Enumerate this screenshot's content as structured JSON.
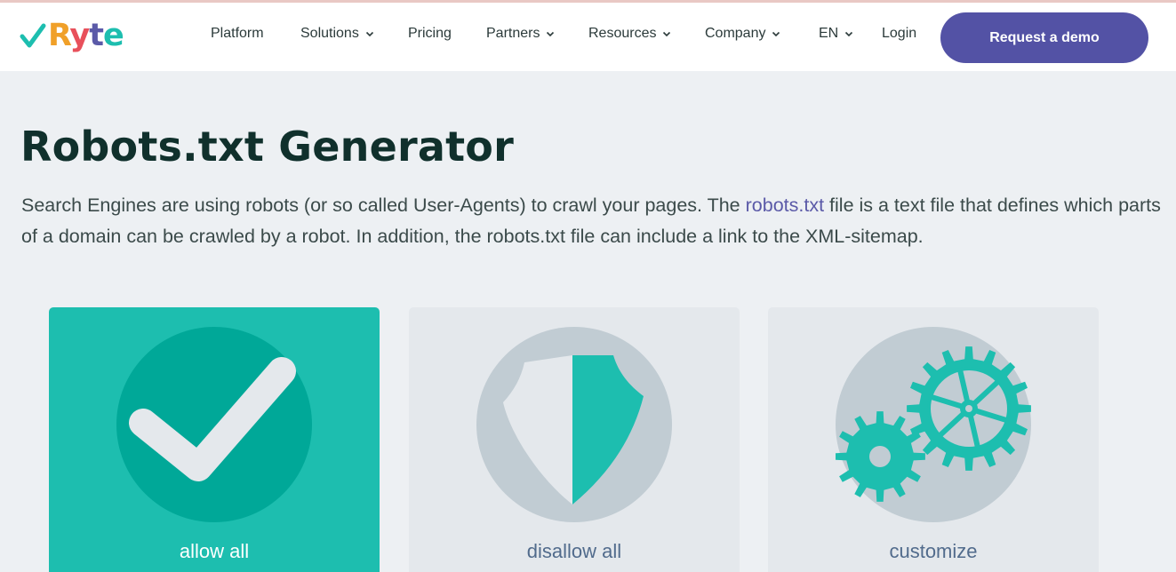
{
  "brand": {
    "name": "Ryte",
    "check_color": "#1dbeaf",
    "letter_colors": [
      "#f0a029",
      "#e8505b",
      "#5b5aa8",
      "#1dbeaf"
    ]
  },
  "nav": {
    "items": [
      {
        "label": "Platform",
        "dropdown": false
      },
      {
        "label": "Solutions",
        "dropdown": true
      },
      {
        "label": "Pricing",
        "dropdown": false
      },
      {
        "label": "Partners",
        "dropdown": true
      },
      {
        "label": "Resources",
        "dropdown": true
      },
      {
        "label": "Company",
        "dropdown": true
      },
      {
        "label": "EN",
        "dropdown": true
      },
      {
        "label": "Login",
        "dropdown": false
      }
    ],
    "cta_label": "Request a demo",
    "cta_color": "#5352a5"
  },
  "page": {
    "title": "Robots.txt Generator",
    "intro_before": "Search Engines are using robots (or so called User-Agents) to crawl your pages. The ",
    "intro_link": "robots.txt",
    "intro_after": " file is a text file that defines which parts of a domain can be crawled by a robot. In addition, the robots.txt file can include a link to the XML-sitemap."
  },
  "options": [
    {
      "label": "allow all",
      "icon": "check-icon",
      "selected": true
    },
    {
      "label": "disallow all",
      "icon": "shield-icon",
      "selected": false
    },
    {
      "label": "customize",
      "icon": "gears-icon",
      "selected": false
    }
  ],
  "colors": {
    "accent": "#1dbeaf",
    "accent_dark": "#00a898",
    "card_bg": "#e4e8ec",
    "icon_circle": "#c1ccd3",
    "title": "#10302c"
  }
}
